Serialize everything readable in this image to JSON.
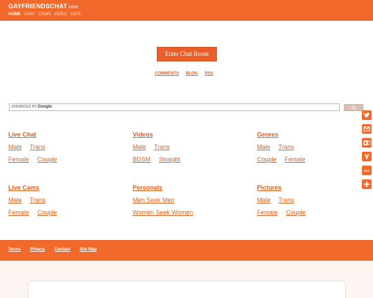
{
  "header": {
    "logo_main": "GAYFRIENDSCHAT",
    "logo_suffix": ".com",
    "nav": [
      "HOME",
      "CHAT",
      "CAMS",
      "VIDEO",
      "DATE"
    ]
  },
  "main": {
    "enter_button": "Enter Chat Room",
    "sublinks": [
      "COMMENTS",
      "BLOG",
      "RSS"
    ]
  },
  "search": {
    "enhanced_by": "ENHANCED BY",
    "google": "Google",
    "icon": "search-icon"
  },
  "categories": [
    {
      "title": "Live Chat",
      "links": [
        "Male",
        "Trans",
        "Female",
        "Couple"
      ]
    },
    {
      "title": "Videos",
      "links": [
        "Male",
        "Trans",
        "BDSM",
        "Straight"
      ]
    },
    {
      "title": "Genres",
      "links": [
        "Male",
        "Trans",
        "Couple",
        "Female"
      ]
    },
    {
      "title": "Live Cams",
      "links": [
        "Male",
        "Trans",
        "Female",
        "Couple"
      ]
    },
    {
      "title": "Personals",
      "links": [
        "Men Seek Men",
        "Women Seek Women"
      ]
    },
    {
      "title": "Pictures",
      "links": [
        "Male",
        "Trans",
        "Female",
        "Couple"
      ]
    }
  ],
  "share": {
    "icons": [
      "twitter-icon",
      "gmail-icon",
      "outlook-icon",
      "yahoo-icon",
      "aol-icon",
      "more-icon"
    ],
    "aol_label": "Aol."
  },
  "footer": {
    "links": [
      "Terms",
      "Privacy",
      "Contact",
      "Site Map"
    ]
  },
  "colors": {
    "brand": "#f26a2b",
    "link": "#e2601d",
    "background": "#fdf5f2"
  }
}
